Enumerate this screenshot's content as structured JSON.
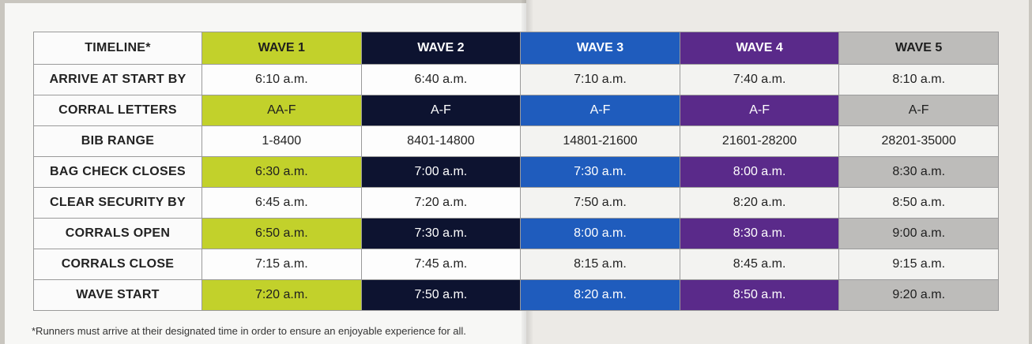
{
  "table": {
    "header": {
      "timeline": "TIMELINE*",
      "waves": [
        "WAVE 1",
        "WAVE 2",
        "WAVE 3",
        "WAVE 4",
        "WAVE 5"
      ]
    },
    "rows": [
      {
        "label": "ARRIVE AT START BY",
        "highlight": false,
        "values": [
          "6:10 a.m.",
          "6:40 a.m.",
          "7:10 a.m.",
          "7:40 a.m.",
          "8:10 a.m."
        ]
      },
      {
        "label": "CORRAL LETTERS",
        "highlight": true,
        "values": [
          "AA-F",
          "A-F",
          "A-F",
          "A-F",
          "A-F"
        ]
      },
      {
        "label": "BIB RANGE",
        "highlight": false,
        "values": [
          "1-8400",
          "8401-14800",
          "14801-21600",
          "21601-28200",
          "28201-35000"
        ]
      },
      {
        "label": "BAG CHECK CLOSES",
        "highlight": true,
        "values": [
          "6:30 a.m.",
          "7:00 a.m.",
          "7:30 a.m.",
          "8:00 a.m.",
          "8:30 a.m."
        ]
      },
      {
        "label": "CLEAR SECURITY BY",
        "highlight": false,
        "values": [
          "6:45 a.m.",
          "7:20 a.m.",
          "7:50 a.m.",
          "8:20 a.m.",
          "8:50 a.m."
        ]
      },
      {
        "label": "CORRALS OPEN",
        "highlight": true,
        "values": [
          "6:50 a.m.",
          "7:30 a.m.",
          "8:00 a.m.",
          "8:30 a.m.",
          "9:00 a.m."
        ]
      },
      {
        "label": "CORRALS CLOSE",
        "highlight": false,
        "values": [
          "7:15 a.m.",
          "7:45 a.m.",
          "8:15 a.m.",
          "8:45 a.m.",
          "9:15 a.m."
        ]
      },
      {
        "label": "WAVE START",
        "highlight": true,
        "values": [
          "7:20 a.m.",
          "7:50 a.m.",
          "8:20 a.m.",
          "8:50 a.m.",
          "9:20 a.m."
        ]
      }
    ]
  },
  "wave_colors": [
    "#c2d12b",
    "#0d1330",
    "#1f5cbd",
    "#5a2a8a",
    "#bdbcba"
  ],
  "footnote": "*Runners must arrive at their designated time in order to ensure an enjoyable experience for all."
}
